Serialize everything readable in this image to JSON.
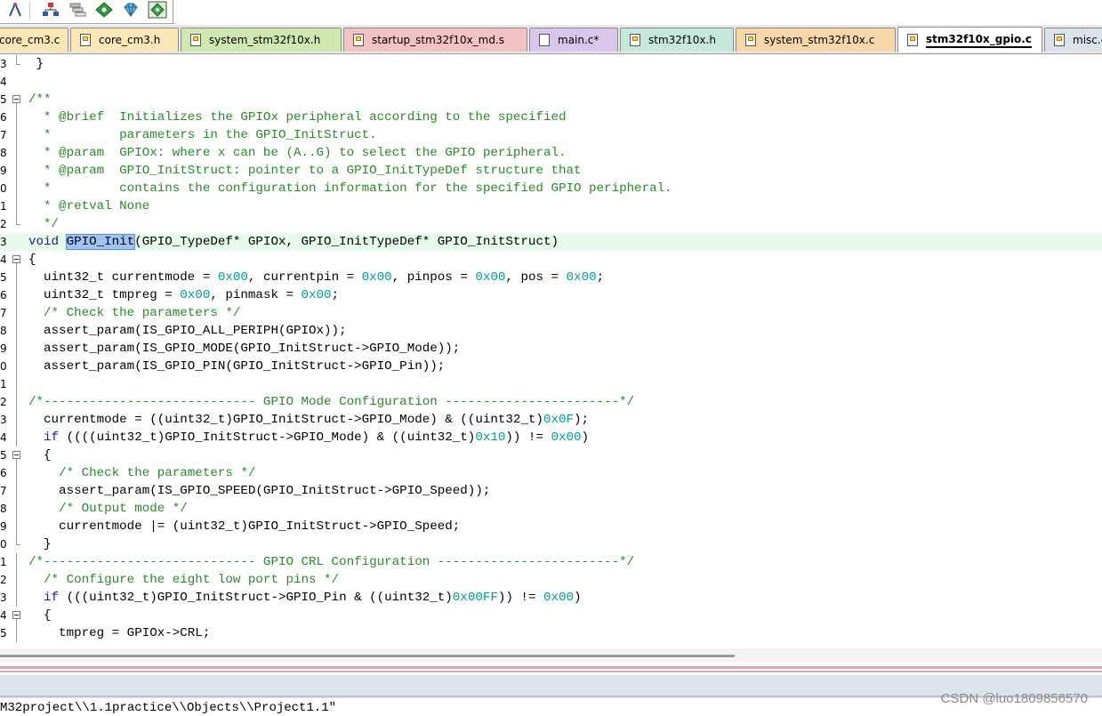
{
  "toolbar": {
    "buttons": [
      {
        "icon": "compass-tool-icon"
      },
      {
        "icon": "component-tree-icon"
      },
      {
        "icon": "stack-layers-icon"
      },
      {
        "icon": "green-diamond-icon"
      },
      {
        "icon": "gem-diamond-icon"
      },
      {
        "icon": "manage-extensions-icon"
      }
    ]
  },
  "tabs": [
    {
      "label": "core_cm3.c",
      "color": "#fbe6b6",
      "icon": "file-icon"
    },
    {
      "label": "core_cm3.h",
      "color": "#fbe6b6",
      "icon": "file-icon"
    },
    {
      "label": "system_stm32f10x.h",
      "color": "#cfe8b0",
      "icon": "file-icon"
    },
    {
      "label": "startup_stm32f10x_md.s",
      "color": "#f3c3c3",
      "icon": "file-icon"
    },
    {
      "label": "main.c*",
      "color": "#d8c7ea",
      "icon": "file-icon"
    },
    {
      "label": "stm32f10x.h",
      "color": "#c6e8dd",
      "icon": "file-icon"
    },
    {
      "label": "system_stm32f10x.c",
      "color": "#f8d7a8",
      "icon": "file-icon"
    },
    {
      "label": "stm32f10x_gpio.c",
      "color": "#ffffff",
      "icon": "file-icon",
      "active": true
    },
    {
      "label": "misc.c",
      "color": "#dce2ea",
      "icon": "file-icon"
    }
  ],
  "editor": {
    "lines": [
      {
        "num": "3",
        "fold": "end",
        "tokens": [
          [
            "pl",
            " }"
          ]
        ]
      },
      {
        "num": "4",
        "fold": "",
        "tokens": []
      },
      {
        "num": "5",
        "fold": "open",
        "tokens": [
          [
            "cm",
            "/**"
          ]
        ]
      },
      {
        "num": "6",
        "fold": "line",
        "tokens": [
          [
            "cm",
            "  * @brief  Initializes the GPIOx peripheral according to the specified"
          ]
        ]
      },
      {
        "num": "7",
        "fold": "line",
        "tokens": [
          [
            "cm",
            "  *         parameters in the GPIO_InitStruct."
          ]
        ]
      },
      {
        "num": "8",
        "fold": "line",
        "tokens": [
          [
            "cm",
            "  * @param  GPIOx: where x can be (A..G) to select the GPIO peripheral."
          ]
        ]
      },
      {
        "num": "9",
        "fold": "line",
        "tokens": [
          [
            "cm",
            "  * @param  GPIO_InitStruct: pointer to a GPIO_InitTypeDef structure that"
          ]
        ]
      },
      {
        "num": "0",
        "fold": "line",
        "tokens": [
          [
            "cm",
            "  *         contains the configuration information for the specified GPIO peripheral."
          ]
        ]
      },
      {
        "num": "1",
        "fold": "line",
        "tokens": [
          [
            "cm",
            "  * @retval None"
          ]
        ]
      },
      {
        "num": "2",
        "fold": "end",
        "tokens": [
          [
            "cm",
            "  */"
          ]
        ]
      },
      {
        "num": "3",
        "fold": "",
        "highlight": true,
        "tokens": [
          [
            "kw",
            "void"
          ],
          [
            "pl",
            " "
          ],
          [
            "sel",
            "GPIO_Init"
          ],
          [
            "pl",
            "(GPIO_TypeDef* GPIOx, GPIO_InitTypeDef* GPIO_InitStruct)"
          ]
        ]
      },
      {
        "num": "4",
        "fold": "open",
        "tokens": [
          [
            "pl",
            "{"
          ]
        ]
      },
      {
        "num": "5",
        "fold": "line",
        "tokens": [
          [
            "pl",
            "  uint32_t currentmode = "
          ],
          [
            "num",
            "0x00"
          ],
          [
            "pl",
            ", currentpin = "
          ],
          [
            "num",
            "0x00"
          ],
          [
            "pl",
            ", pinpos = "
          ],
          [
            "num",
            "0x00"
          ],
          [
            "pl",
            ", pos = "
          ],
          [
            "num",
            "0x00"
          ],
          [
            "pl",
            ";"
          ]
        ]
      },
      {
        "num": "6",
        "fold": "line",
        "tokens": [
          [
            "pl",
            "  uint32_t tmpreg = "
          ],
          [
            "num",
            "0x00"
          ],
          [
            "pl",
            ", pinmask = "
          ],
          [
            "num",
            "0x00"
          ],
          [
            "pl",
            ";"
          ]
        ]
      },
      {
        "num": "7",
        "fold": "line",
        "tokens": [
          [
            "pl",
            "  "
          ],
          [
            "cm",
            "/* Check the parameters */"
          ]
        ]
      },
      {
        "num": "8",
        "fold": "line",
        "tokens": [
          [
            "pl",
            "  assert_param(IS_GPIO_ALL_PERIPH(GPIOx));"
          ]
        ]
      },
      {
        "num": "9",
        "fold": "line",
        "tokens": [
          [
            "pl",
            "  assert_param(IS_GPIO_MODE(GPIO_InitStruct->GPIO_Mode));"
          ]
        ]
      },
      {
        "num": "0",
        "fold": "line",
        "tokens": [
          [
            "pl",
            "  assert_param(IS_GPIO_PIN(GPIO_InitStruct->GPIO_Pin));"
          ]
        ]
      },
      {
        "num": "1",
        "fold": "line",
        "tokens": []
      },
      {
        "num": "2",
        "fold": "line",
        "tokens": [
          [
            "cm",
            "/*---------------------------- GPIO Mode Configuration -----------------------*/"
          ]
        ]
      },
      {
        "num": "3",
        "fold": "line",
        "tokens": [
          [
            "pl",
            "  currentmode = ((uint32_t)GPIO_InitStruct->GPIO_Mode) & ((uint32_t)"
          ],
          [
            "num",
            "0x0F"
          ],
          [
            "pl",
            ");"
          ]
        ]
      },
      {
        "num": "4",
        "fold": "line",
        "tokens": [
          [
            "pl",
            "  "
          ],
          [
            "kw",
            "if"
          ],
          [
            "pl",
            " ((((uint32_t)GPIO_InitStruct->GPIO_Mode) & ((uint32_t)"
          ],
          [
            "num",
            "0x10"
          ],
          [
            "pl",
            ")) != "
          ],
          [
            "num",
            "0x00"
          ],
          [
            "pl",
            ")"
          ]
        ]
      },
      {
        "num": "5",
        "fold": "open",
        "tokens": [
          [
            "pl",
            "  {"
          ]
        ]
      },
      {
        "num": "6",
        "fold": "line",
        "tokens": [
          [
            "pl",
            "    "
          ],
          [
            "cm",
            "/* Check the parameters */"
          ]
        ]
      },
      {
        "num": "7",
        "fold": "line",
        "tokens": [
          [
            "pl",
            "    assert_param(IS_GPIO_SPEED(GPIO_InitStruct->GPIO_Speed));"
          ]
        ]
      },
      {
        "num": "8",
        "fold": "line",
        "tokens": [
          [
            "pl",
            "    "
          ],
          [
            "cm",
            "/* Output mode */"
          ]
        ]
      },
      {
        "num": "9",
        "fold": "line",
        "tokens": [
          [
            "pl",
            "    currentmode |= (uint32_t)GPIO_InitStruct->GPIO_Speed;"
          ]
        ]
      },
      {
        "num": "0",
        "fold": "end",
        "tokens": [
          [
            "pl",
            "  }"
          ]
        ]
      },
      {
        "num": "1",
        "fold": "line",
        "tokens": [
          [
            "cm",
            "/*---------------------------- GPIO CRL Configuration ------------------------*/"
          ]
        ]
      },
      {
        "num": "2",
        "fold": "line",
        "tokens": [
          [
            "pl",
            "  "
          ],
          [
            "cm",
            "/* Configure the eight low port pins */"
          ]
        ]
      },
      {
        "num": "3",
        "fold": "line",
        "tokens": [
          [
            "pl",
            "  "
          ],
          [
            "kw",
            "if"
          ],
          [
            "pl",
            " (((uint32_t)GPIO_InitStruct->GPIO_Pin & ((uint32_t)"
          ],
          [
            "num",
            "0x00FF"
          ],
          [
            "pl",
            ")) != "
          ],
          [
            "num",
            "0x00"
          ],
          [
            "pl",
            ")"
          ]
        ]
      },
      {
        "num": "4",
        "fold": "open",
        "tokens": [
          [
            "pl",
            "  {"
          ]
        ]
      },
      {
        "num": "5",
        "fold": "line",
        "tokens": [
          [
            "pl",
            "    tmpreg = GPIOx->CRL;"
          ]
        ]
      }
    ]
  },
  "output": {
    "text": "M32project\\\\1.1practice\\\\Objects\\\\Project1.1\""
  },
  "watermark": "CSDN @luo1809856570",
  "colors": {
    "keyword": "#1a1aa6",
    "number": "#009d9d",
    "comment": "#2b8a2b",
    "current_line": "#e6fbea",
    "selection": "#9fc3f2"
  }
}
